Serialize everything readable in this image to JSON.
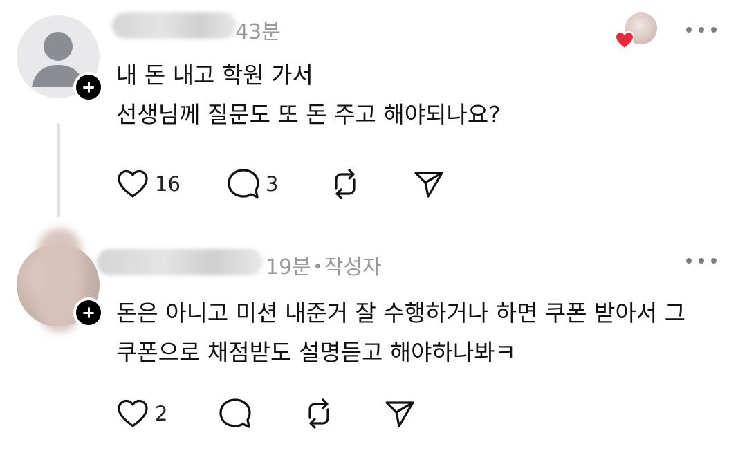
{
  "posts": [
    {
      "time": "43분",
      "author_tag": "",
      "lines": [
        "내 돈 내고 학원 가서",
        "선생님께 질문도 또 돈 주고 해야되나요?"
      ],
      "likes": "16",
      "replies": "3",
      "liked_by_icon": "heart-icon",
      "accent": "#e8283c"
    },
    {
      "time": "19분",
      "author_tag": "작성자",
      "lines": [
        "돈은 아니고 미션 내준거 잘 수행하거나 하면 쿠폰 받아서 그",
        "쿠폰으로 채점받도 설명듣고 해야하나봐ㅋ"
      ],
      "likes": "2",
      "replies": ""
    }
  ],
  "icons": [
    "person-icon",
    "plus-icon",
    "more-icon",
    "heart-icon",
    "comment-icon",
    "repost-icon",
    "send-icon"
  ],
  "colors": {
    "text": "#111111",
    "muted": "#999999",
    "like_red": "#e8283c",
    "badge": "#000000",
    "avatar_bg": "#e9e9ec",
    "avatar_person": "#8a8d94"
  }
}
